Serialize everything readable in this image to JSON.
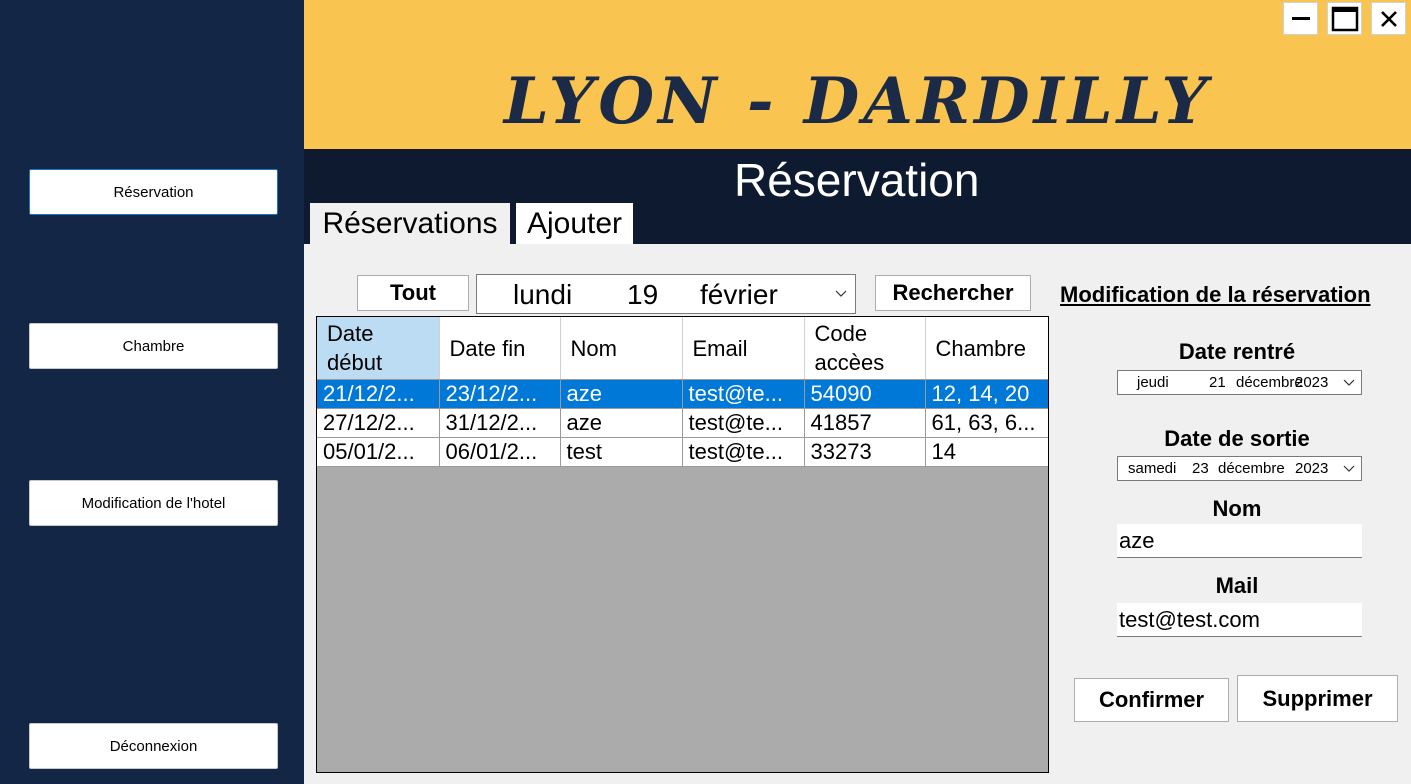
{
  "sidebar": {
    "items": [
      {
        "label": "Réservation"
      },
      {
        "label": "Chambre"
      },
      {
        "label": "Modification de l'hotel"
      },
      {
        "label": "Déconnexion"
      }
    ]
  },
  "header": {
    "brand": "LYON - DARDILLY",
    "page_title": "Réservation",
    "window_controls": [
      "minimize-icon",
      "maximize-icon",
      "close-icon"
    ]
  },
  "tabs": [
    {
      "label": "Réservations"
    },
    {
      "label": "Ajouter"
    }
  ],
  "filter": {
    "all_label": "Tout",
    "date": {
      "day": "lundi",
      "num": "19",
      "month": "février"
    },
    "search_label": "Rechercher"
  },
  "table": {
    "headers": [
      "Date début",
      "Date fin",
      "Nom",
      "Email",
      "Code accèes",
      "Chambre"
    ],
    "rows": [
      [
        "21/12/2...",
        "23/12/2...",
        "aze",
        "test@te...",
        "54090",
        "12, 14, 20"
      ],
      [
        "27/12/2...",
        "31/12/2...",
        "aze",
        "test@te...",
        "41857",
        "61, 63, 6..."
      ],
      [
        "05/01/2...",
        "06/01/2...",
        "test",
        "test@te...",
        "33273",
        "14"
      ]
    ]
  },
  "edit_panel": {
    "title": "Modification de la réservation",
    "date_in_label": "Date rentré",
    "date_in": {
      "day": "jeudi",
      "num": "21",
      "month": "décembre",
      "year": "2023"
    },
    "date_out_label": "Date de sortie",
    "date_out": {
      "day": "samedi",
      "num": "23",
      "month": "décembre",
      "year": "2023"
    },
    "name_label": "Nom",
    "name_value": "aze",
    "mail_label": "Mail",
    "mail_value": "test@test.com",
    "confirm_label": "Confirmer",
    "delete_label": "Supprimer"
  },
  "colors": {
    "sidebar": "#142645",
    "banner": "#f9c44f",
    "header_dark": "#0d1a30",
    "selection": "#0078d7"
  }
}
